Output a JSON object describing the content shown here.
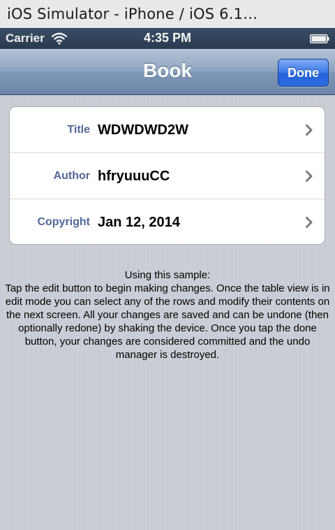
{
  "window": {
    "title": "iOS Simulator - iPhone / iOS 6.1…"
  },
  "statusbar": {
    "carrier": "Carrier",
    "time": "4:35 PM"
  },
  "navbar": {
    "title": "Book",
    "done_label": "Done"
  },
  "table": {
    "rows": [
      {
        "label": "Title",
        "value": "WDWDWD2W"
      },
      {
        "label": "Author",
        "value": "hfryuuuCC"
      },
      {
        "label": "Copyright",
        "value": "Jan 12, 2014"
      }
    ]
  },
  "instructions": {
    "heading": "Using this sample:",
    "body": "Tap the edit button to begin making changes.  Once the table view is in edit mode you can select any of the rows and modify their contents on the next screen.  All your changes are saved and can be undone (then optionally redone) by shaking the device.  Once you tap the done button, your changes are considered committed and the undo manager is destroyed."
  },
  "colors": {
    "nav_tint": "#7f97b5",
    "done_button": "#2b6be0",
    "row_label": "#52669a",
    "background": "#c8ccd4"
  },
  "icons": {
    "wifi": "wifi-icon",
    "battery": "battery-icon",
    "disclosure": "chevron-right-icon"
  }
}
